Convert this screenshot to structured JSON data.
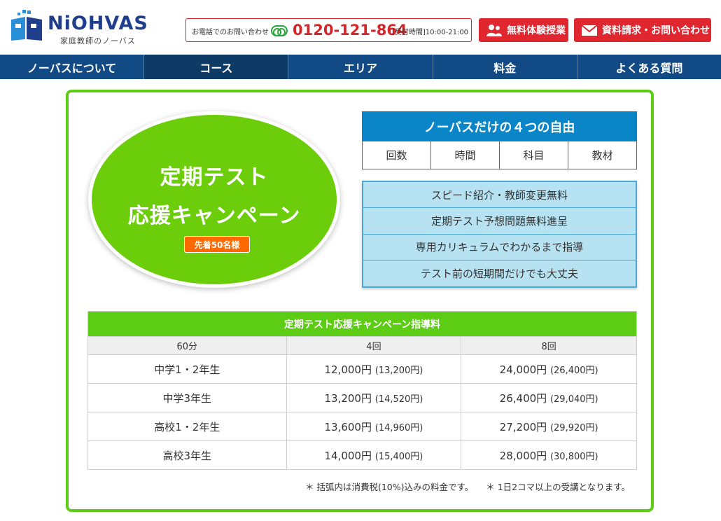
{
  "header": {
    "logo_text": "NiOHVAS",
    "logo_sub": "家庭教師のノーバス",
    "tel_label": "お電話でのお問い合わせ",
    "tel_number": "0120-121-864",
    "tel_hours": "[受付時間]10:00-21:00",
    "trial_button": "無料体験授業",
    "contact_button": "資料請求・お問い合わせ",
    "colors": {
      "brand_blue": "#1f3e8c",
      "red": "#e0262e",
      "green": "#2aa63a"
    }
  },
  "nav": {
    "items": [
      "ノーバスについて",
      "コース",
      "エリア",
      "料金",
      "よくある質問"
    ],
    "active_index": 1
  },
  "campaign": {
    "title_line1": "定期テスト",
    "title_line2": "応援キャンペーン",
    "badge": "先着50名様",
    "colors": {
      "green": "#6cce0a",
      "badge": "#ff6a00"
    }
  },
  "freedoms": {
    "title": "ノーバスだけの４つの自由",
    "items": [
      "回数",
      "時間",
      "科目",
      "教材"
    ]
  },
  "features": {
    "items": [
      "スピード紹介・教師変更無料",
      "定期テスト予想問題無料進呈",
      "専用カリキュラムでわかるまで指導",
      "テスト前の短期間だけでも大丈夫"
    ]
  },
  "price_table": {
    "caption": "定期テスト応援キャンペーン指導料",
    "headers": [
      "60分",
      "4回",
      "8回"
    ],
    "rows": [
      {
        "grade": "中学1・2年生",
        "p4": "12,000円",
        "p4_tax": "(13,200円)",
        "p8": "24,000円",
        "p8_tax": "(26,400円)"
      },
      {
        "grade": "中学3年生",
        "p4": "13,200円",
        "p4_tax": "(14,520円)",
        "p8": "26,400円",
        "p8_tax": "(29,040円)"
      },
      {
        "grade": "高校1・2年生",
        "p4": "13,600円",
        "p4_tax": "(14,960円)",
        "p8": "27,200円",
        "p8_tax": "(29,920円)"
      },
      {
        "grade": "高校3年生",
        "p4": "14,000円",
        "p4_tax": "(15,400円)",
        "p8": "28,000円",
        "p8_tax": "(30,800円)"
      }
    ]
  },
  "notes": [
    "＊ 括弧内は消費税(10%)込みの料金です。",
    "＊ 1日2コマ以上の受講となります。"
  ]
}
